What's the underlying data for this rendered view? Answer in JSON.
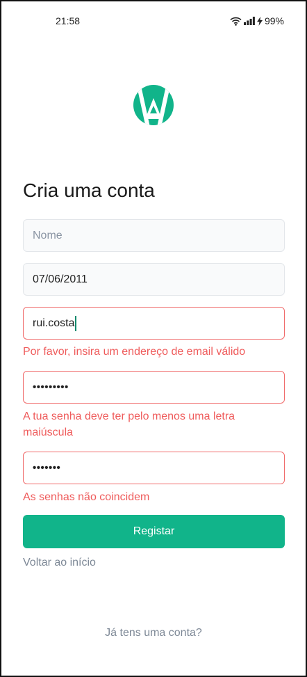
{
  "status_bar": {
    "time": "21:58",
    "battery": "99%",
    "icons": [
      "wifi-icon",
      "signal-icon",
      "charging-icon"
    ]
  },
  "brand": {
    "accent": "#11b48a",
    "error": "#ef5b5b"
  },
  "form": {
    "title": "Cria uma conta",
    "name": {
      "placeholder": "Nome",
      "value": ""
    },
    "birthdate": {
      "value": "07/06/2011"
    },
    "email": {
      "value": "rui.costa",
      "error": "Por favor, insira um endereço de email válido"
    },
    "password": {
      "value": "•••••••••",
      "error": "A tua senha deve ter pelo menos uma letra maiúscula"
    },
    "confirm_password": {
      "value": "•••••••",
      "error": "As senhas não coincidem"
    },
    "submit_label": "Registar",
    "back_label": "Voltar ao início",
    "login_link": "Já tens uma conta?"
  }
}
